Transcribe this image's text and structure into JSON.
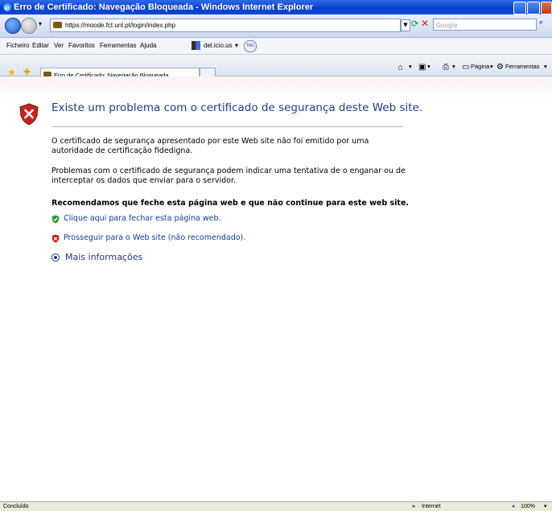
{
  "window": {
    "title": "Erro de Certificado: Navegação Bloqueada - Windows Internet Explorer"
  },
  "address": {
    "url": "https://moode.fct.unl.pt/login/index.php"
  },
  "search": {
    "placeholder": "Google"
  },
  "menu": {
    "items": [
      "Ficheiro",
      "Editar",
      "Ver",
      "Favoritos",
      "Ferramentas",
      "Ajuda"
    ],
    "delicious": "del.icio.us",
    "tag": "TAG"
  },
  "tab": {
    "label": "Erro de Certificado: Navegação Bloqueada"
  },
  "tools": {
    "page": "Página",
    "tools": "Ferramentas"
  },
  "content": {
    "heading": "Existe um problema com o certificado de segurança deste Web site.",
    "para1": "O certificado de segurança apresentado por este Web site não foi emitido por uma autoridade de certificação fidedigna.",
    "para2": "Problemas com o certificado de segurança podem indicar uma tentativa de o enganar ou de interceptar os dados que enviar para o servidor.",
    "recommendation": "Recomendamos que feche esta página web e que não continue para este web site.",
    "close_link": "Clique aqui para fechar esta página web.",
    "continue_link": "Prosseguir para o Web site (não recomendado).",
    "more_info": "Mais informações"
  },
  "status": {
    "left": "Concluído",
    "zone": "Internet",
    "zoom": "100%"
  },
  "colors": {
    "accent": "#1f3c8a",
    "link": "#0b3e9a",
    "title_bar": "#0a3fc8",
    "error": "#c0261b",
    "ok": "#2e9a2e"
  }
}
